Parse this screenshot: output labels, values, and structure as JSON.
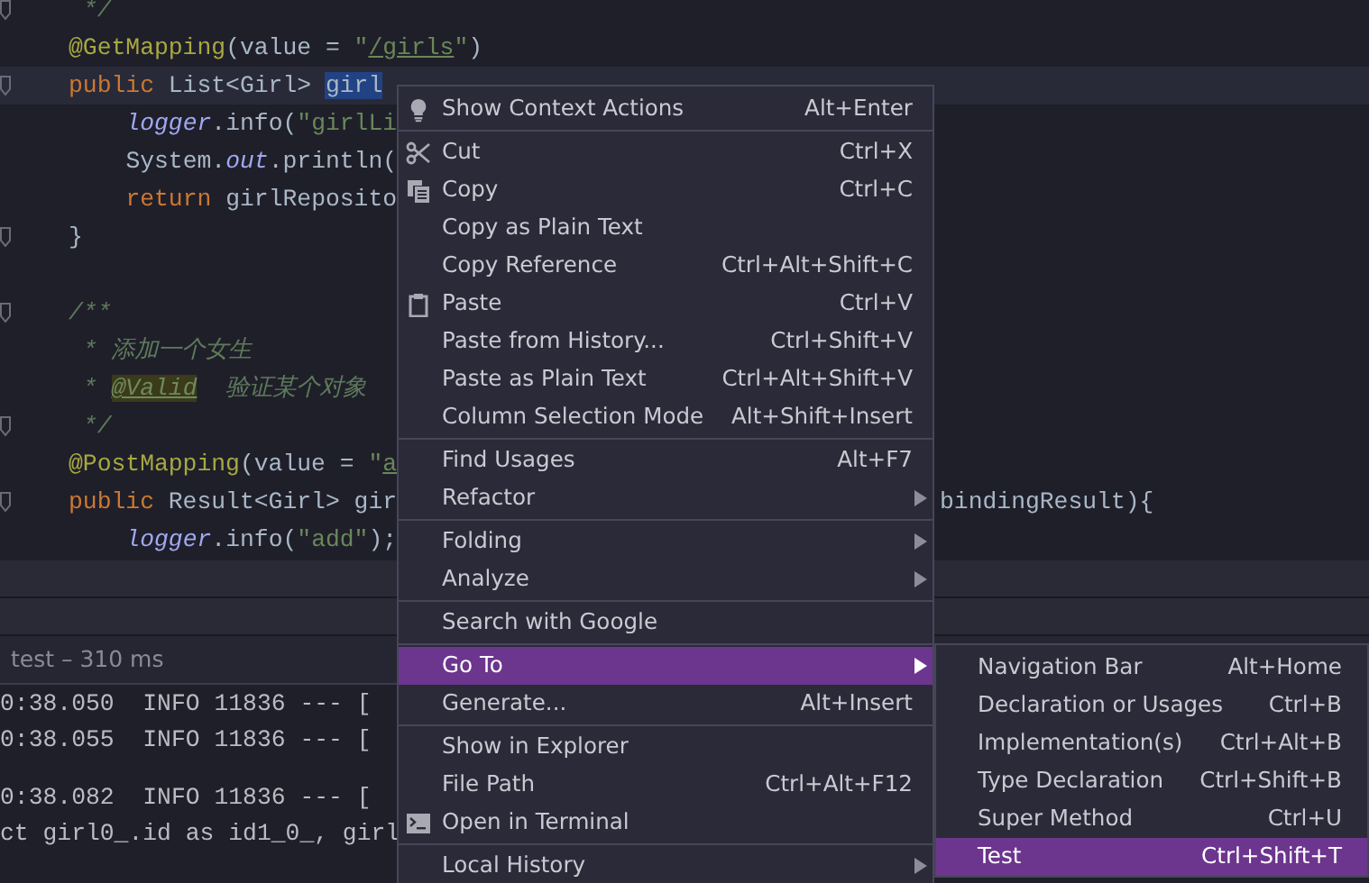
{
  "editor": {
    "lines": [
      {
        "tokens": [
          {
            "text": " */",
            "kind": "comment"
          }
        ],
        "current": false,
        "fold": true,
        "blank_before": false
      },
      {
        "tokens": [
          {
            "text": "@GetMapping",
            "kind": "annotation"
          },
          {
            "text": "(value = ",
            "kind": "plain"
          },
          {
            "text": "\"",
            "kind": "string"
          },
          {
            "text": "/girls",
            "kind": "link"
          },
          {
            "text": "\"",
            "kind": "string"
          },
          {
            "text": ")",
            "kind": "plain"
          }
        ],
        "current": false,
        "fold": false,
        "blank_before": false
      },
      {
        "tokens": [
          {
            "text": "public",
            "kind": "keyword"
          },
          {
            "text": " List<Girl> ",
            "kind": "plain"
          },
          {
            "text": "girl",
            "kind": "selection"
          }
        ],
        "current": true,
        "fold": true,
        "blank_before": false,
        "children": [
          {
            "tokens": [
              {
                "text": "logger",
                "kind": "field"
              },
              {
                "text": ".info(",
                "kind": "plain"
              },
              {
                "text": "\"girlLi",
                "kind": "string"
              }
            ],
            "current": false,
            "fold": false,
            "blank_before": false
          },
          {
            "tokens": [
              {
                "text": "System.",
                "kind": "plain"
              },
              {
                "text": "out",
                "kind": "field"
              },
              {
                "text": ".println(",
                "kind": "plain"
              }
            ],
            "current": false,
            "fold": false,
            "blank_before": false
          },
          {
            "tokens": [
              {
                "text": "return",
                "kind": "keyword"
              },
              {
                "text": " girlReposito",
                "kind": "plain"
              }
            ],
            "current": false,
            "fold": false,
            "blank_before": false
          }
        ]
      },
      {
        "tokens": [
          {
            "text": "}",
            "kind": "plain"
          }
        ],
        "current": false,
        "fold": true,
        "blank_before": false
      },
      {
        "tokens": [
          {
            "text": "/**",
            "kind": "comment"
          }
        ],
        "current": false,
        "fold": true,
        "blank_before": true
      },
      {
        "tokens": [
          {
            "text": " * 添加一个女生",
            "kind": "comment"
          }
        ],
        "current": false,
        "fold": false,
        "blank_before": false
      },
      {
        "tokens": [
          {
            "text": " * ",
            "kind": "comment"
          },
          {
            "text": "@Valid",
            "kind": "doctag"
          },
          {
            "text": "  验证某个对象",
            "kind": "comment"
          }
        ],
        "current": false,
        "fold": false,
        "blank_before": false
      },
      {
        "tokens": [
          {
            "text": " */",
            "kind": "comment"
          }
        ],
        "current": false,
        "fold": true,
        "blank_before": false
      },
      {
        "tokens": [
          {
            "text": "@PostMapping",
            "kind": "annotation"
          },
          {
            "text": "(value = ",
            "kind": "plain"
          },
          {
            "text": "\"",
            "kind": "string"
          },
          {
            "text": "a",
            "kind": "link"
          }
        ],
        "current": false,
        "fold": false,
        "blank_before": false
      },
      {
        "tokens": [
          {
            "text": "public",
            "kind": "keyword"
          },
          {
            "text": " Result<Girl> gir",
            "kind": "plain"
          }
        ],
        "right": "bindingResult){",
        "current": false,
        "fold": true,
        "blank_before": false,
        "children": [
          {
            "tokens": [
              {
                "text": "logger",
                "kind": "field"
              },
              {
                "text": ".info(",
                "kind": "plain"
              },
              {
                "text": "\"add\"",
                "kind": "string"
              },
              {
                "text": ");",
                "kind": "plain"
              }
            ],
            "current": false,
            "fold": false,
            "blank_before": false
          }
        ]
      }
    ]
  },
  "run_panel": {
    "status": "test – 310 ms",
    "console": [
      {
        "text": "0:38.050  INFO 11836 --- [",
        "blank_before": false
      },
      {
        "text": "0:38.055  INFO 11836 --- [",
        "blank_before": false
      },
      {
        "text": "0:38.082  INFO 11836 --- [",
        "blank_before": true
      },
      {
        "text": "ct girl0_.id as id1_0_, girl",
        "blank_before": false
      }
    ]
  },
  "context_menu": {
    "groups": [
      [
        {
          "label": "Show Context Actions",
          "shortcut": "Alt+Enter",
          "submenu": false,
          "selected": false
        }
      ],
      [
        {
          "label": "Cut",
          "shortcut": "Ctrl+X",
          "submenu": false,
          "selected": false
        },
        {
          "label": "Copy",
          "shortcut": "Ctrl+C",
          "submenu": false,
          "selected": false
        },
        {
          "label": "Copy as Plain Text",
          "submenu": false,
          "selected": false
        },
        {
          "label": "Copy Reference",
          "shortcut": "Ctrl+Alt+Shift+C",
          "submenu": false,
          "selected": false
        },
        {
          "label": "Paste",
          "shortcut": "Ctrl+V",
          "submenu": false,
          "selected": false
        },
        {
          "label": "Paste from History...",
          "shortcut": "Ctrl+Shift+V",
          "submenu": false,
          "selected": false
        },
        {
          "label": "Paste as Plain Text",
          "shortcut": "Ctrl+Alt+Shift+V",
          "submenu": false,
          "selected": false
        },
        {
          "label": "Column Selection Mode",
          "shortcut": "Alt+Shift+Insert",
          "submenu": false,
          "selected": false
        }
      ],
      [
        {
          "label": "Find Usages",
          "shortcut": "Alt+F7",
          "submenu": false,
          "selected": false
        },
        {
          "label": "Refactor",
          "submenu": true,
          "selected": false
        }
      ],
      [
        {
          "label": "Folding",
          "submenu": true,
          "selected": false
        },
        {
          "label": "Analyze",
          "submenu": true,
          "selected": false
        }
      ],
      [
        {
          "label": "Search with Google",
          "submenu": false,
          "selected": false
        }
      ],
      [
        {
          "label": "Go To",
          "submenu": true,
          "selected": true
        },
        {
          "label": "Generate...",
          "shortcut": "Alt+Insert",
          "submenu": false,
          "selected": false
        }
      ],
      [
        {
          "label": "Show in Explorer",
          "submenu": false,
          "selected": false
        },
        {
          "label": "File Path",
          "shortcut": "Ctrl+Alt+F12",
          "submenu": false,
          "selected": false
        },
        {
          "label": "Open in Terminal",
          "submenu": false,
          "selected": false
        }
      ],
      [
        {
          "label": "Local History",
          "submenu": true,
          "selected": false
        }
      ]
    ]
  },
  "goto_submenu": {
    "items": [
      {
        "label": "Navigation Bar",
        "shortcut": "Alt+Home",
        "selected": false
      },
      {
        "label": "Declaration or Usages",
        "shortcut": "Ctrl+B",
        "selected": false
      },
      {
        "label": "Implementation(s)",
        "shortcut": "Ctrl+Alt+B",
        "selected": false
      },
      {
        "label": "Type Declaration",
        "shortcut": "Ctrl+Shift+B",
        "selected": false
      },
      {
        "label": "Super Method",
        "shortcut": "Ctrl+U",
        "selected": false
      },
      {
        "label": "Test",
        "shortcut": "Ctrl+Shift+T",
        "selected": true
      }
    ]
  }
}
